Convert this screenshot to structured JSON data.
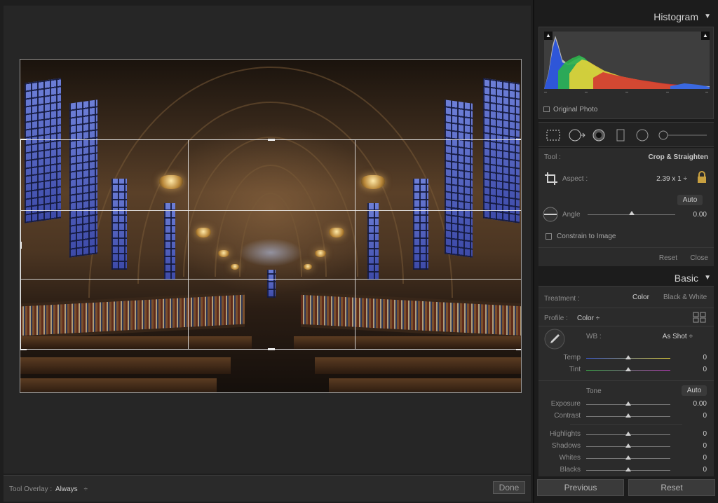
{
  "toolbar": {
    "overlay_label": "Tool Overlay :",
    "overlay_value": "Always",
    "overlay_arrow": "÷",
    "done_label": "Done"
  },
  "histogram": {
    "title": "Histogram",
    "collapse_arrow": "▼",
    "original_photo_label": "Original Photo"
  },
  "crop": {
    "tool_label": "Tool :",
    "tool_value": "Crop & Straighten",
    "aspect_label": "Aspect :",
    "aspect_value": "2.39 x 1",
    "aspect_arrow": "÷",
    "auto_label": "Auto",
    "angle_label": "Angle",
    "angle_value": "0.00",
    "angle_position": 0.5,
    "constrain_label": "Constrain to Image",
    "reset_label": "Reset",
    "close_label": "Close"
  },
  "basic": {
    "title": "Basic",
    "collapse_arrow": "▼",
    "treatment_label": "Treatment :",
    "treatment_color": "Color",
    "treatment_bw": "Black & White",
    "profile_label": "Profile :",
    "profile_value": "Color",
    "profile_arrow": "÷",
    "wb_label": "WB :",
    "wb_value": "As Shot",
    "wb_arrow": "÷",
    "tone_label": "Tone",
    "tone_auto": "Auto",
    "sliders": [
      {
        "label": "Temp",
        "value": "0",
        "position": 0.5
      },
      {
        "label": "Tint",
        "value": "0",
        "position": 0.5
      },
      {
        "label": "Exposure",
        "value": "0.00",
        "position": 0.5
      },
      {
        "label": "Contrast",
        "value": "0",
        "position": 0.5
      },
      {
        "label": "Highlights",
        "value": "0",
        "position": 0.5
      },
      {
        "label": "Shadows",
        "value": "0",
        "position": 0.5
      },
      {
        "label": "Whites",
        "value": "0",
        "position": 0.5
      },
      {
        "label": "Blacks",
        "value": "0",
        "position": 0.5
      }
    ]
  },
  "buttons": {
    "previous_label": "Previous",
    "reset_label": "Reset"
  },
  "colors": {
    "panel_bg": "#2b2b2b",
    "accent": "#cfcfcf"
  }
}
